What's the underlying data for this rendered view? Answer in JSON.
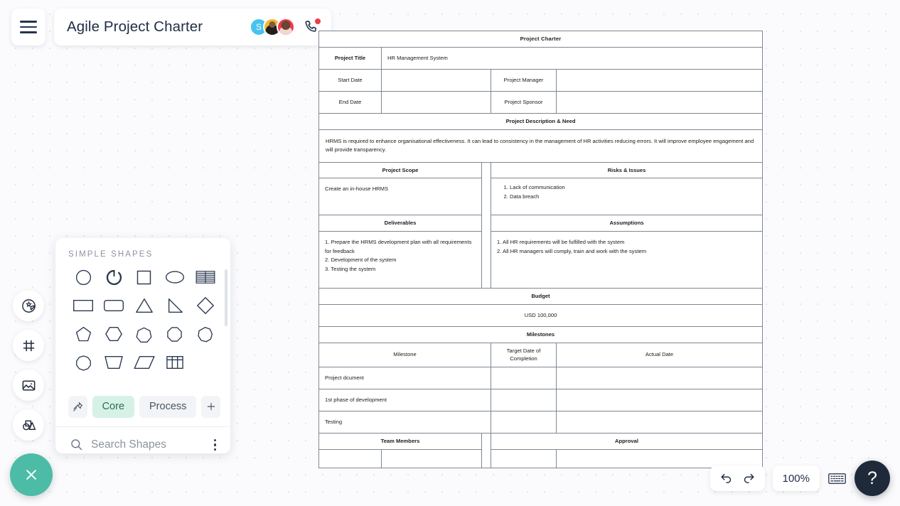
{
  "topbar": {
    "menu_icon": "hamburger-icon",
    "doc_title": "Agile Project Charter",
    "avatars": [
      {
        "initial": "S",
        "color": "#46c3ee"
      },
      {
        "initial": "",
        "color": "#f5b731"
      },
      {
        "initial": "",
        "color": "#ef3b4e"
      }
    ],
    "call_icon": "phone-icon",
    "call_badge": true
  },
  "left_toolbar": {
    "items": [
      {
        "name": "sticker-icon",
        "label": "Stickers"
      },
      {
        "name": "frame-icon",
        "label": "Frames"
      },
      {
        "name": "image-icon",
        "label": "Images"
      },
      {
        "name": "shapes-icon",
        "label": "Shapes"
      }
    ],
    "close_button": {
      "name": "close-icon",
      "color": "#4cbca7"
    }
  },
  "shapes_panel": {
    "heading": "SIMPLE SHAPES",
    "shapes": [
      "circle",
      "arc",
      "square",
      "ellipse",
      "table-stripes",
      "rectangle",
      "rounded-rectangle",
      "triangle",
      "right-triangle",
      "diamond",
      "pentagon",
      "hexagon",
      "heptagon",
      "octagon",
      "nonagon",
      "decagon",
      "trapezoid",
      "parallelogram",
      "table-grid"
    ],
    "tabs": [
      {
        "label": "",
        "icon": "pin-icon",
        "active": false
      },
      {
        "label": "Core",
        "icon": "",
        "active": true
      },
      {
        "label": "Process",
        "icon": "",
        "active": false
      },
      {
        "label": "+",
        "icon": "plus-icon",
        "active": false
      }
    ],
    "search_placeholder": "Search Shapes",
    "search_icon": "search-icon",
    "more_icon": "kebab-menu-icon"
  },
  "document": {
    "title": "Project Charter",
    "project_title_label": "Project Title",
    "project_title_value": "HR Management System",
    "start_date_label": "Start Date",
    "start_date_value": "",
    "project_manager_label": "Project Manager",
    "project_manager_value": "",
    "end_date_label": "End Date",
    "end_date_value": "",
    "project_sponsor_label": "Project Sponsor",
    "project_sponsor_value": "",
    "description_header": "Project Description & Need",
    "description_text": "HRMS is required to enhance organisational effectiveness. It can lead to consistency in the management of HR activities reducing errors. It will improve employee engagement and will provide transparency.",
    "scope_header": "Project Scope",
    "scope_text": "Create an in-house HRMS",
    "risks_header": "Risks & Issues",
    "risks_items": [
      "Lack of communication",
      "Data breach"
    ],
    "deliverables_header": "Deliverables",
    "deliverables_items": [
      "1. Prepare the HRMS development plan with all requirements for feedback",
      "2. Development of the system",
      "3. Testing the system"
    ],
    "assumptions_header": "Assumptions",
    "assumptions_items": [
      "1. All HR requirements will be fulfilled with the system",
      "2. All HR managers will comply, train and work with the system"
    ],
    "budget_header": "Budget",
    "budget_value": "USD 100,000",
    "milestones_header": "Milestones",
    "milestone_columns": [
      "Milestone",
      "Target Date of Completion",
      "Actual Date"
    ],
    "milestone_rows": [
      {
        "milestone": "Project dcument",
        "target": "",
        "actual": ""
      },
      {
        "milestone": "1st phase of development",
        "target": "",
        "actual": ""
      },
      {
        "milestone": "Testing",
        "target": "",
        "actual": ""
      }
    ],
    "team_members_header": "Team Members",
    "approval_header": "Approval",
    "colors": {
      "title_teal": "#3f9387",
      "header_orange": "#ed9851",
      "header_yellow": "#f2d754",
      "subheader_cream": "#fcf0dc",
      "subheader_bluegray": "#eef1f5",
      "divider_gray": "#94a3b8"
    }
  },
  "bottom_bar": {
    "save_icon": "cloud-check-icon",
    "undo_icon": "undo-icon",
    "redo_icon": "redo-icon",
    "zoom_level": "100%",
    "keyboard_icon": "keyboard-icon",
    "help_label": "?"
  }
}
